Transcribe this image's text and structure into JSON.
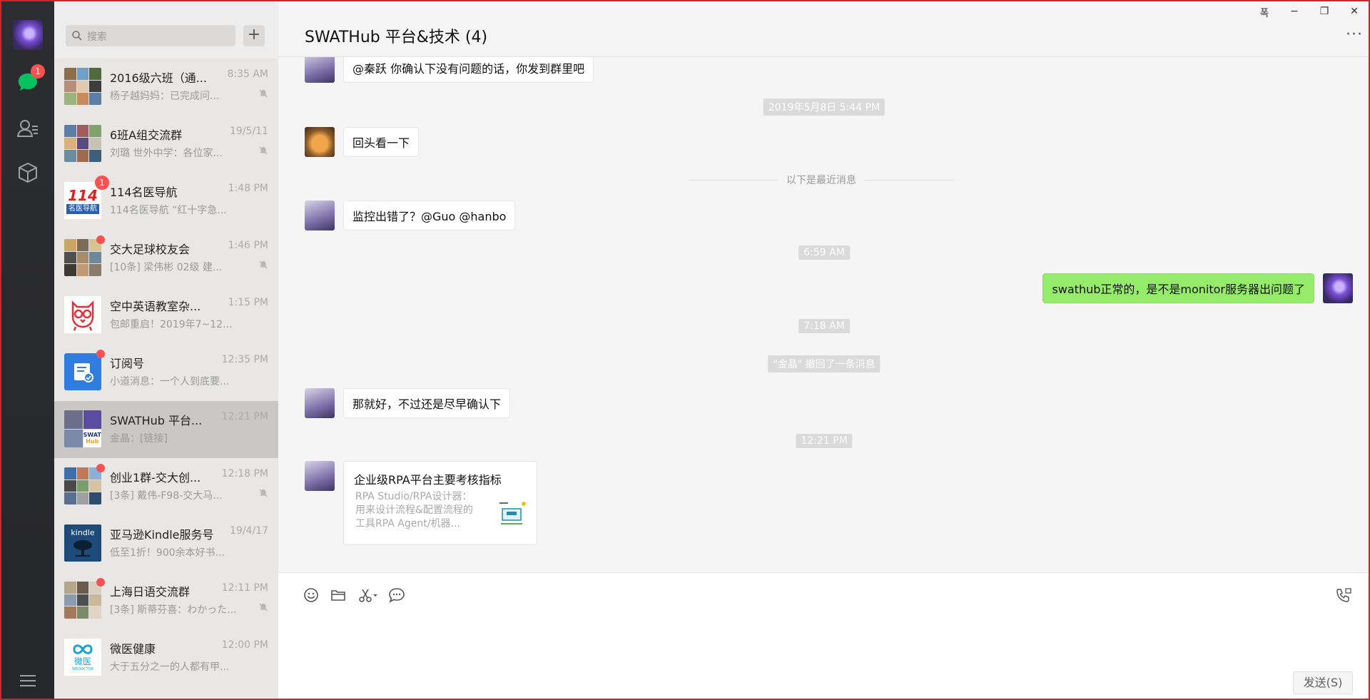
{
  "nav": {
    "chat_badge": "1"
  },
  "search": {
    "placeholder": "搜索",
    "add_label": "+"
  },
  "conversations": [
    {
      "title": "2016级六班（通...",
      "time": "8:35 AM",
      "preview": "杨子越妈妈：已完成问...",
      "muted": true
    },
    {
      "title": "6班A组交流群",
      "time": "19/5/11",
      "preview": "刘璐 世外中学：各位家...",
      "muted": true
    },
    {
      "title": "114名医导航",
      "time": "1:48 PM",
      "preview": "114名医导航 “红十字急...",
      "badge": "1",
      "logo_text": "114",
      "logo_sub": "名医导航"
    },
    {
      "title": "交大足球校友会",
      "time": "1:46 PM",
      "preview": "[10条] 梁伟彬 02级 建...",
      "muted": true
    },
    {
      "title": "空中英语教室杂...",
      "time": "1:15 PM",
      "preview": "包邮重启！2019年7~12..."
    },
    {
      "title": "订阅号",
      "time": "12:35 PM",
      "preview": "小道消息：一个人到底要..."
    },
    {
      "title": "SWATHub 平台...",
      "time": "12:21 PM",
      "preview": "金晶：[链接]",
      "logo_text": "SWAT",
      "logo_sub": "Hub"
    },
    {
      "title": "创业1群-交大创...",
      "time": "12:18 PM",
      "preview": "[3条] 戴伟-F98-交大马...",
      "muted": true
    },
    {
      "title": "亚马逊Kindle服务号",
      "time": "19/4/17",
      "preview": "低至1折！900余本好书...",
      "logo_text": "kindle"
    },
    {
      "title": "上海日语交流群",
      "time": "12:11 PM",
      "preview": "[3条] 斯蒂芬喜：わかった...",
      "muted": true
    },
    {
      "title": "微医健康",
      "time": "12:00 PM",
      "preview": "大于五分之一的人都有甲...",
      "logo_text": "微医",
      "logo_sub": "WEDOCTOR"
    }
  ],
  "chat": {
    "title": "SWATHub 平台&技术 (4)",
    "more": "···",
    "messages": {
      "m1": "@秦跃 你确认下没有问题的话，你发到群里吧",
      "ts1": "2019年5月8日 5:44 PM",
      "m2": "回头看一下",
      "divider": "以下是最近消息",
      "m3": "监控出错了？@Guo @hanbo",
      "ts2": "6:59 AM",
      "m4": "swathub正常的，是不是monitor服务器出问题了",
      "ts3": "7:18 AM",
      "recall": "\"金晶\" 撤回了一条消息",
      "m5": "那就好，不过还是尽早确认下",
      "ts4": "12:21 PM",
      "card_title": "企业级RPA平台主要考核指标",
      "card_desc": "RPA Studio/RPA设计器：用来设计流程&配置流程的工具RPA Agent/机器..."
    }
  },
  "composer": {
    "send_label": "发送(S)"
  },
  "window": {
    "pin": "폭",
    "minimize": "−",
    "restore": "❐",
    "close": "✕"
  },
  "colors": {
    "accent_green": "#95ec69",
    "badge_red": "#fa5151",
    "nav_bg": "#2c2d31"
  }
}
